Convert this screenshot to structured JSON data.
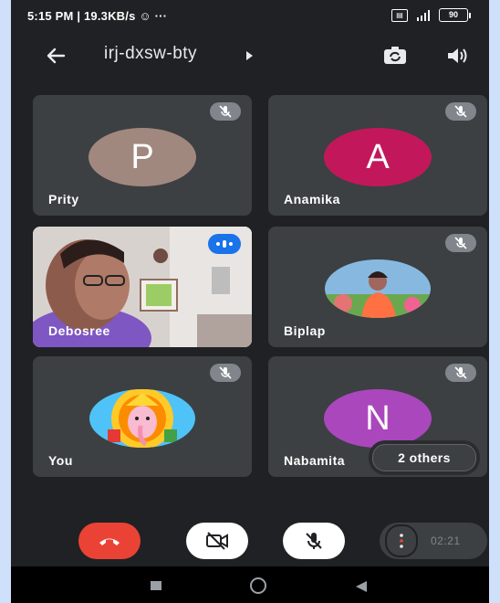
{
  "status_bar": {
    "text": "5:15 PM | 19.3KB/s ☺ ···",
    "sim_label": "VoLTE",
    "battery": "90"
  },
  "app_bar": {
    "meeting_code": "irj-dxsw-bty"
  },
  "participants": [
    {
      "name": "Prity",
      "initial": "P",
      "color": "#a1887f",
      "muted": true
    },
    {
      "name": "Anamika",
      "initial": "A",
      "color": "#c2185b",
      "muted": true
    },
    {
      "name": "Debosree",
      "initial": "",
      "color": "",
      "muted": false,
      "speaking": true
    },
    {
      "name": "Biplap",
      "initial": "",
      "color": "",
      "muted": true
    },
    {
      "name": "You",
      "initial": "",
      "color": "",
      "muted": true
    },
    {
      "name": "Nabamita",
      "initial": "N",
      "color": "#ab47bc",
      "muted": true
    }
  ],
  "others_label": "2 others",
  "controls": {
    "timer": "02:21"
  },
  "colors": {
    "background": "#202124",
    "tile": "#3c4043",
    "end_call": "#ea4335",
    "accent": "#1a73e8"
  },
  "icons": [
    "back-arrow-icon",
    "camera-switch-icon",
    "speaker-icon",
    "mic-off-icon",
    "hang-up-icon",
    "camera-off-icon",
    "more-icon"
  ]
}
